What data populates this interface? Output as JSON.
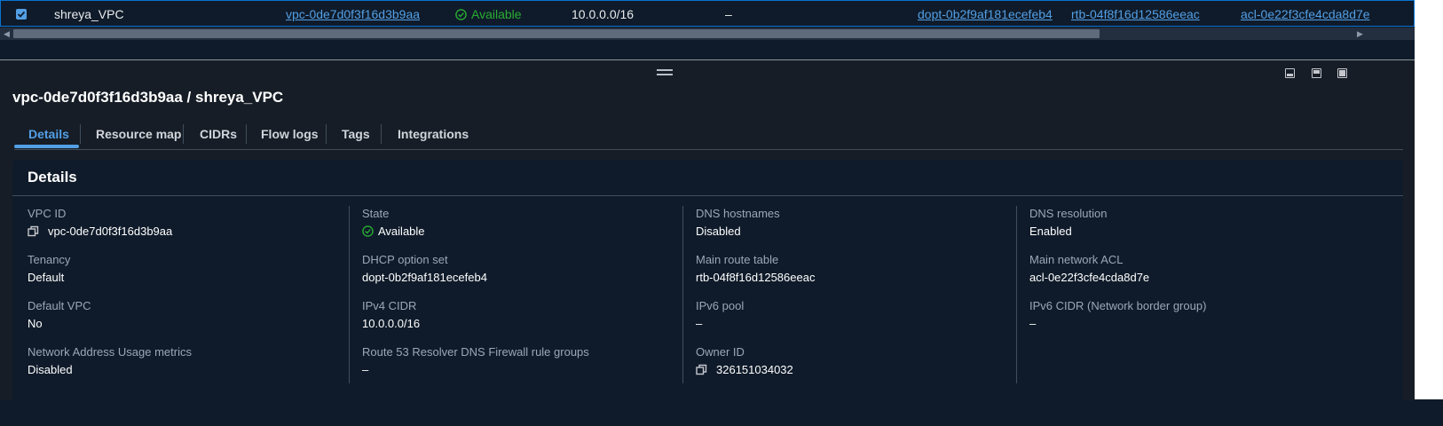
{
  "row": {
    "name": "shreya_VPC",
    "vpc_id": "vpc-0de7d0f3f16d3b9aa",
    "state": "Available",
    "ipv4_cidr": "10.0.0.0/16",
    "ipv6_cidr": "–",
    "dhcp_option_set": "dopt-0b2f9af181ecefeb4",
    "main_route_table": "rtb-04f8f16d12586eeac",
    "main_network_acl": "acl-0e22f3cfe4cda8d7e"
  },
  "panel": {
    "title": "vpc-0de7d0f3f16d3b9aa / shreya_VPC",
    "tabs": [
      "Details",
      "Resource map",
      "CIDRs",
      "Flow logs",
      "Tags",
      "Integrations"
    ],
    "active_tab": "Details"
  },
  "details": {
    "title": "Details",
    "columns": [
      [
        {
          "label": "VPC ID",
          "value": "vpc-0de7d0f3f16d3b9aa"
        },
        {
          "label": "Tenancy",
          "value": "Default"
        },
        {
          "label": "Default VPC",
          "value": "No"
        },
        {
          "label": "Network Address Usage metrics",
          "value": "Disabled"
        }
      ],
      [
        {
          "label": "State",
          "value": "Available"
        },
        {
          "label": "DHCP option set",
          "value": "dopt-0b2f9af181ecefeb4"
        },
        {
          "label": "IPv4 CIDR",
          "value": "10.0.0.0/16"
        },
        {
          "label": "Route 53 Resolver DNS Firewall rule groups",
          "value": "–"
        }
      ],
      [
        {
          "label": "DNS hostnames",
          "value": "Disabled"
        },
        {
          "label": "Main route table",
          "value": "rtb-04f8f16d12586eeac"
        },
        {
          "label": "IPv6 pool",
          "value": "–"
        },
        {
          "label": "Owner ID",
          "value": "326151034032"
        }
      ],
      [
        {
          "label": "DNS resolution",
          "value": "Enabled"
        },
        {
          "label": "Main network ACL",
          "value": "acl-0e22f3cfe4cda8d7e"
        },
        {
          "label": "IPv6 CIDR (Network border group)",
          "value": "–"
        }
      ]
    ]
  },
  "colors": {
    "link": "#539fe5",
    "success": "#29ad32",
    "panel_bg": "#161d26",
    "page_bg": "#0f1b2a"
  },
  "icons": [
    "check-icon",
    "status-available-icon",
    "copy-icon",
    "drag-handle-icon",
    "panel-bottom-icon",
    "panel-side-icon",
    "panel-fullscreen-icon",
    "arrow-left-icon",
    "arrow-right-icon"
  ]
}
